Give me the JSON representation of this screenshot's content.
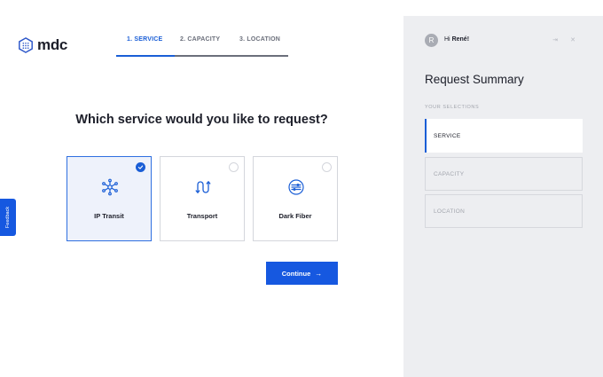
{
  "logo": {
    "text": "mdc",
    "icon": "mdc-logo-icon"
  },
  "steps": [
    {
      "label": "1. SERVICE",
      "active": true
    },
    {
      "label": "2. CAPACITY",
      "active": false
    },
    {
      "label": "3. LOCATION",
      "active": false
    }
  ],
  "heading": "Which service would you like to request?",
  "services": [
    {
      "label": "IP Transit",
      "icon": "network-nodes-icon",
      "selected": true
    },
    {
      "label": "Transport",
      "icon": "route-icon",
      "selected": false
    },
    {
      "label": "Dark Fiber",
      "icon": "fiber-icon",
      "selected": false
    }
  ],
  "continue": {
    "label": "Continue",
    "icon": "arrow-right-icon"
  },
  "feedback": {
    "label": "Feedback"
  },
  "sidebar": {
    "avatar_letter": "R",
    "greeting_prefix": "Hi",
    "user_name": "René!",
    "title": "Request Summary",
    "section_label": "YOUR SELECTIONS",
    "selections": [
      {
        "label": "SERVICE",
        "active": true
      },
      {
        "label": "CAPACITY",
        "active": false
      },
      {
        "label": "LOCATION",
        "active": false
      }
    ]
  },
  "colors": {
    "accent": "#1658e0",
    "sidebar_bg": "#edeef1",
    "selected_card_bg": "#eef2fb"
  }
}
